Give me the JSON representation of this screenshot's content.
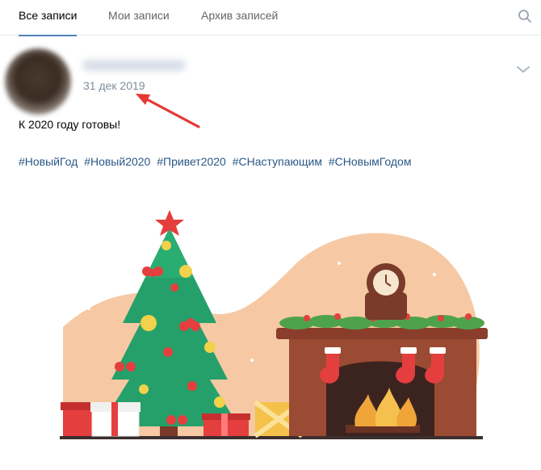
{
  "tabs": [
    {
      "label": "Все записи",
      "active": true
    },
    {
      "label": "Мои записи",
      "active": false
    },
    {
      "label": "Архив записей",
      "active": false
    }
  ],
  "post": {
    "date": "31 дек 2019",
    "text": "К 2020 году готовы!",
    "hashtags": [
      "#НовыйГод",
      "#Новый2020",
      "#Привет2020",
      "#СНаступающим",
      "#СНовымГодом"
    ]
  },
  "icons": {
    "search": "search-icon",
    "more": "chevron-down-icon",
    "annotation": "red-arrow-icon"
  },
  "colors": {
    "accent": "#5181b8",
    "link": "#2a5885",
    "date": "#818c99",
    "annotation": "#e53935"
  }
}
